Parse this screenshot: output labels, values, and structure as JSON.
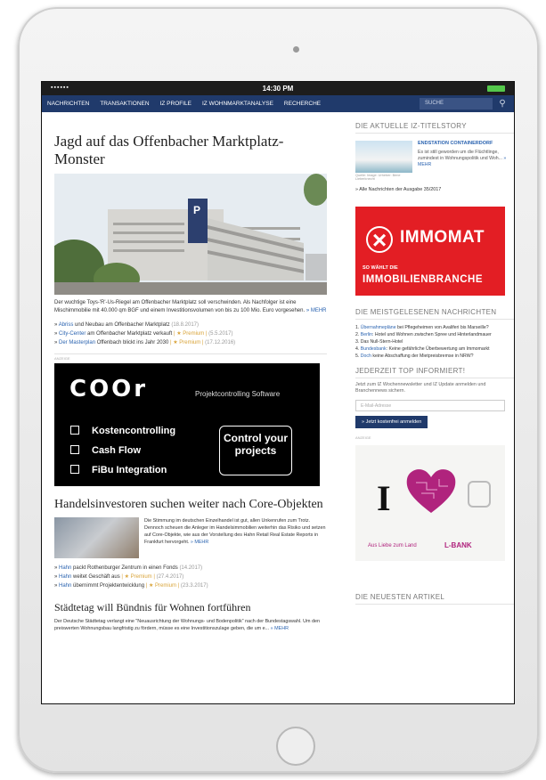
{
  "status": {
    "signal": "▪▪▪▪▪▪",
    "time": "14:30 PM"
  },
  "nav": {
    "items": [
      "NACHRICHTEN",
      "TRANSAKTIONEN",
      "IZ PROFILE",
      "IZ WOHNMARKTANALYSE",
      "RECHERCHE"
    ],
    "search_placeholder": "SUCHE"
  },
  "article1": {
    "title": "Jagd auf das Offenbacher Marktplatz-Monster",
    "lead": "Der wuchtige Toys-'R'-Us-Riegel am Offenbacher Marktplatz soll verschwinden. Als Nachfolger ist eine Mischimmobilie mit 40.000 qm BGF und einem Investitionsvolumen von bis zu 100 Mio. Euro vorgesehen.",
    "more": "» MEHR",
    "related": [
      {
        "link": "Abriss",
        "text": " und Neubau am Offenbacher Marktplatz",
        "date": "(18.8.2017)",
        "premium": ""
      },
      {
        "link": "City-Center",
        "text": " am Offenbacher Marktplatz verkauft",
        "date": "(5.5.2017)",
        "premium": "| ★ Premium |"
      },
      {
        "link": "Der Masterplan",
        "text": " Offenbach blickt ins Jahr 2030",
        "date": "(17.12.2016)",
        "premium": "| ★ Premium |"
      }
    ]
  },
  "ad_label": "ANZEIGE",
  "coor_ad": {
    "logo": "COOr",
    "tagline": "Projektcontrolling Software",
    "features": [
      "Kostencontrolling",
      "Cash Flow",
      "FiBu Integration"
    ],
    "cta": "Control your projects"
  },
  "article2": {
    "title": "Handelsinvestoren suchen weiter nach Core-Objekten",
    "body": "Die Stimmung im deutschen Einzelhandel ist gut, allen Unkenrufen zum Trotz. Dennoch scheuen die Anleger im Handelsimmobilien weiterhin das Risiko und setzen auf Core-Objekte, wie aus der Vorstellung des Hahn Retail Real Estate Reports in Frankfurt hervorgeht.",
    "more": "» MEHR",
    "related": [
      {
        "link": "Hahn",
        "text": " packt Rothenburger Zentrum in einen Fonds",
        "date": "(14.2017)",
        "premium": ""
      },
      {
        "link": "Hahn",
        "text": " weitet Geschäft aus",
        "date": "(27.4.2017)",
        "premium": "| ★ Premium |"
      },
      {
        "link": "Hahn",
        "text": " übernimmt Projektentwicklung",
        "date": "(23.3.2017)",
        "premium": "| ★ Premium |"
      }
    ]
  },
  "article3": {
    "title": "Städtetag will Bündnis für Wohnen fortführen",
    "body": "Der Deutsche Städtetag verlangt eine \"Neuausrichtung der Wohnungs- und Bodenpolitik\" nach der Bundestagswahl. Um den preiswerten Wohnungsbau langfristig zu fördern, müsse es eine Investitionszulage geben, die um e...",
    "more": "» MEHR"
  },
  "sidebar": {
    "title_story_heading": "DIE AKTUELLE IZ-TITELSTORY",
    "story_kicker": "ENDSTATION CONTAINERDORF",
    "story_text": "Es ist still geworden um die Flüchtlinge, zumindest in Wohnungspolitik und Woh...",
    "story_more": "» MEHR",
    "story_caption": "Quelle: Image: Urheber: Bene Lieberknecht",
    "all_news": "» Alle Nachrichten der Ausgabe 35/2017",
    "immomat": {
      "word": "IMMOMAT",
      "sub1": "SO WÄHLT DIE",
      "sub2": "IMMOBILIENBRANCHE"
    },
    "most_read_heading": "DIE MEISTGELESENEN NACHRICHTEN",
    "most_read": [
      {
        "link": "Übernahmepläne",
        "text": " bei Pflegeheimen von Avaliferi bis Marseille?"
      },
      {
        "link": "Berlin",
        "text": ": Hotel und Wohnen zwischen Spree und Hinterlandmauer"
      },
      {
        "link": "",
        "text": "Das Null-Stern-Hotel"
      },
      {
        "link": "Bundesbank",
        "text": ": Keine gefährliche Überbewertung am Immomarkt"
      },
      {
        "link": "Doch",
        "text": " keine Abschaffung der Mietpreisbremse in NRW?"
      }
    ],
    "newsletter_heading": "JEDERZEIT TOP INFORMIERT!",
    "newsletter_text": "Jetzt zum IZ Wochennewsletter und IZ Update anmelden und Branchennews sichern.",
    "email_placeholder": "E-Mail-Adresse",
    "subscribe_button": "» Jetzt kostenfrei anmelden",
    "lbank": {
      "I": "I",
      "tagline": "Aus Liebe zum Land",
      "bank": "L-BANK"
    },
    "newest_heading": "DIE NEUESTEN ARTIKEL"
  }
}
